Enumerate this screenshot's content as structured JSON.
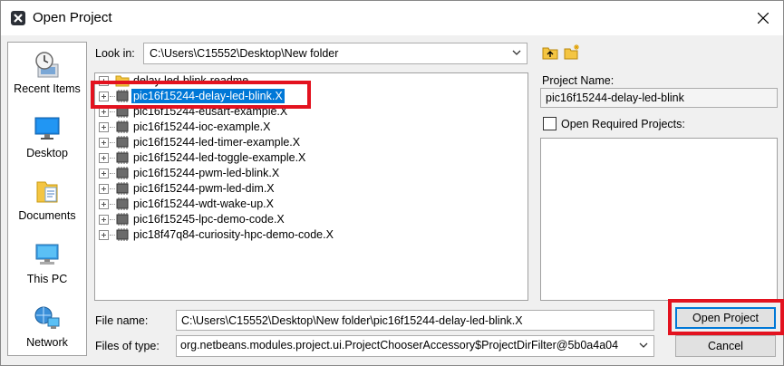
{
  "window": {
    "title": "Open Project"
  },
  "places": [
    {
      "label": "Recent Items",
      "icon": "recent-items-icon"
    },
    {
      "label": "Desktop",
      "icon": "desktop-icon"
    },
    {
      "label": "Documents",
      "icon": "documents-icon"
    },
    {
      "label": "This PC",
      "icon": "this-pc-icon"
    },
    {
      "label": "Network",
      "icon": "network-icon"
    }
  ],
  "look_in": {
    "label": "Look in:",
    "value": "C:\\Users\\C15552\\Desktop\\New folder"
  },
  "files": [
    {
      "name": "delay-led-blink-readme",
      "type": "folder"
    },
    {
      "name": "pic16f15244-delay-led-blink.X",
      "type": "project",
      "selected": true
    },
    {
      "name": "pic16f15244-eusart-example.X",
      "type": "project"
    },
    {
      "name": "pic16f15244-ioc-example.X",
      "type": "project"
    },
    {
      "name": "pic16f15244-led-timer-example.X",
      "type": "project"
    },
    {
      "name": "pic16f15244-led-toggle-example.X",
      "type": "project"
    },
    {
      "name": "pic16f15244-pwm-led-blink.X",
      "type": "project"
    },
    {
      "name": "pic16f15244-pwm-led-dim.X",
      "type": "project"
    },
    {
      "name": "pic16f15244-wdt-wake-up.X",
      "type": "project"
    },
    {
      "name": "pic16f15245-lpc-demo-code.X",
      "type": "project"
    },
    {
      "name": "pic18f47q84-curiosity-hpc-demo-code.X",
      "type": "project"
    }
  ],
  "project_name": {
    "label": "Project Name:",
    "value": "pic16f15244-delay-led-blink"
  },
  "open_required": {
    "label": "Open Required Projects:",
    "checked": false
  },
  "file_name": {
    "label": "File name:",
    "value": "C:\\Users\\C15552\\Desktop\\New folder\\pic16f15244-delay-led-blink.X"
  },
  "files_of_type": {
    "label": "Files of type:",
    "value": "org.netbeans.modules.project.ui.ProjectChooserAccessory$ProjectDirFilter@5b0a4a04"
  },
  "buttons": {
    "open": "Open Project",
    "cancel": "Cancel"
  },
  "colors": {
    "selection": "#0078d7",
    "highlight": "#e3121f"
  }
}
